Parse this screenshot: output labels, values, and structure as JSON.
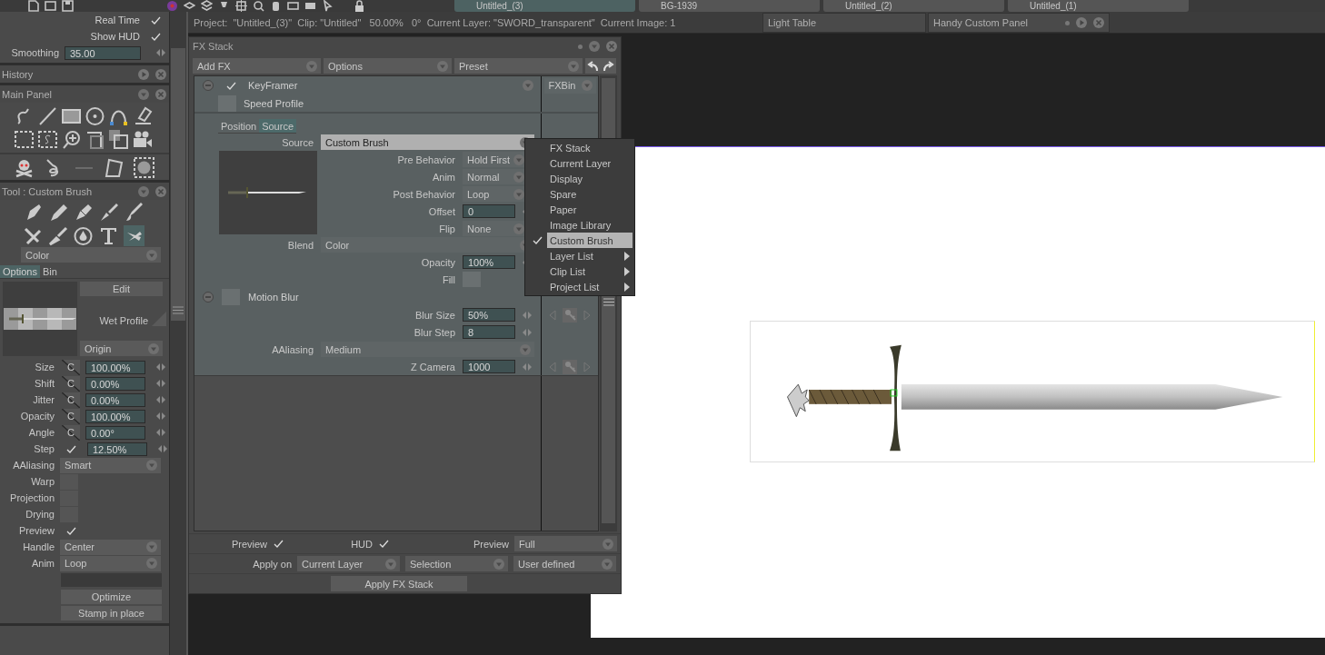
{
  "doc_tabs": [
    {
      "label": "Untitled_(3)",
      "selected": true
    },
    {
      "label": "BG-1939",
      "selected": false
    },
    {
      "label": "Untitled_(2)",
      "selected": false
    },
    {
      "label": "Untitled_(1)",
      "selected": false
    }
  ],
  "status_line": "Project:  \"Untitled_(3)\"  Clip: \"Untitled\"   50.00%   0°  Current Layer: \"SWORD_transparent\"  Current Image: 1",
  "light_table": {
    "title": "Light Table"
  },
  "handy_panel": {
    "title": "Handy Custom Panel"
  },
  "left_panel": {
    "toggles": [
      {
        "label": "Real Time",
        "checked": true
      },
      {
        "label": "Show HUD",
        "checked": true
      }
    ],
    "smoothing": {
      "label": "Smoothing",
      "value": "35.00"
    },
    "history": {
      "title": "History"
    },
    "main_panel": {
      "title": "Main Panel"
    },
    "tool_panel": {
      "title": "Tool : Custom Brush",
      "brush_tools": [
        {
          "selected": false
        },
        {
          "selected": false
        },
        {
          "selected": false
        },
        {
          "selected": false
        },
        {
          "selected": false
        },
        {
          "selected": false
        },
        {
          "selected": false
        },
        {
          "selected": false
        },
        {
          "selected": false
        },
        {
          "selected": true
        }
      ],
      "color_dropdown": "Color",
      "tabs": [
        {
          "label": "Options",
          "selected": true
        },
        {
          "label": "Bin",
          "selected": false
        }
      ],
      "edit_button": "Edit",
      "wet_profile": "Wet Profile",
      "origin": "Origin",
      "rows": [
        {
          "kind": "numeric",
          "label": "Size",
          "toggle": "C",
          "value": "100.00%"
        },
        {
          "kind": "numeric",
          "label": "Shift",
          "toggle": "C",
          "value": "0.00%"
        },
        {
          "kind": "numeric",
          "label": "Jitter",
          "toggle": "C",
          "value": "0.00%"
        },
        {
          "kind": "numeric",
          "label": "Opacity",
          "toggle": "C",
          "value": "100.00%"
        },
        {
          "kind": "numeric",
          "label": "Angle",
          "toggle": "C",
          "value": "0.00°"
        },
        {
          "kind": "numeric",
          "label": "Step",
          "checked": true,
          "value": "12.50%"
        },
        {
          "kind": "dropdown",
          "label": "AAliasing",
          "value": "Smart"
        },
        {
          "kind": "swatch",
          "label": "Warp"
        },
        {
          "kind": "swatch",
          "label": "Projection"
        },
        {
          "kind": "swatch",
          "label": "Drying"
        },
        {
          "kind": "check",
          "label": "Preview",
          "checked": true
        },
        {
          "kind": "dropdown",
          "label": "Handle",
          "value": "Center"
        },
        {
          "kind": "dropdown",
          "label": "Anim",
          "value": "Loop"
        }
      ],
      "buttons": [
        "Optimize",
        "Stamp in place"
      ]
    }
  },
  "fx_stack": {
    "title": "FX Stack",
    "toolbar": [
      "Add FX",
      "Options",
      "Preset"
    ],
    "fx_bin": "FXBin",
    "effects": [
      {
        "name": "KeyFramer",
        "enabled": true,
        "sub_toggle": {
          "label": "Speed Profile",
          "checked": false
        },
        "tabs": [
          {
            "label": "Position",
            "selected": false
          },
          {
            "label": "Source",
            "selected": true
          }
        ],
        "params": [
          {
            "kind": "wide_dropdown",
            "label": "Source",
            "value": "Custom Brush",
            "open": true
          },
          {
            "kind": "thumb_group",
            "items": [
              {
                "kind": "dropdown",
                "label": "Pre Behavior",
                "value": "Hold First"
              },
              {
                "kind": "dropdown",
                "label": "Anim",
                "value": "Normal"
              },
              {
                "kind": "dropdown",
                "label": "Post Behavior",
                "value": "Loop"
              },
              {
                "kind": "numeric",
                "label": "Offset",
                "value": "0"
              },
              {
                "kind": "dropdown",
                "label": "Flip",
                "value": "None"
              }
            ]
          },
          {
            "kind": "wide_dropdown",
            "label": "Blend",
            "value": "Color",
            "open": false
          },
          {
            "kind": "numeric",
            "label": "Opacity",
            "value": "100%"
          },
          {
            "kind": "swatch",
            "label": "Fill"
          }
        ]
      },
      {
        "name": "Motion Blur",
        "enabled": false,
        "params": [
          {
            "kind": "numeric",
            "label": "Blur Size",
            "value": "50%",
            "keyframes": true
          },
          {
            "kind": "numeric",
            "label": "Blur Step",
            "value": "8"
          },
          {
            "kind": "wide_dropdown",
            "label": "AAliasing",
            "value": "Medium",
            "open": false
          },
          {
            "kind": "numeric",
            "label": "Z Camera",
            "value": "1000",
            "keyframes": true
          }
        ]
      }
    ],
    "footer": {
      "preview": {
        "label": "Preview",
        "checked": true
      },
      "hud": {
        "label": "HUD",
        "checked": true
      },
      "preview_mode": {
        "label": "Preview",
        "value": "Full"
      },
      "apply_on": {
        "label": "Apply on",
        "options": [
          "Current Layer",
          "Selection",
          "User defined"
        ]
      },
      "apply_button": "Apply FX Stack"
    }
  },
  "source_menu": {
    "items": [
      {
        "label": "FX Stack",
        "selected": false,
        "submenu": false
      },
      {
        "label": "Current Layer",
        "selected": false,
        "submenu": false
      },
      {
        "label": "Display",
        "selected": false,
        "submenu": false
      },
      {
        "label": "Spare",
        "selected": false,
        "submenu": false
      },
      {
        "label": "Paper",
        "selected": false,
        "submenu": false
      },
      {
        "label": "Image Library",
        "selected": false,
        "submenu": false
      },
      {
        "label": "Custom Brush",
        "selected": true,
        "submenu": false
      },
      {
        "label": "Layer List",
        "selected": false,
        "submenu": true
      },
      {
        "label": "Clip List",
        "selected": false,
        "submenu": true
      },
      {
        "label": "Project List",
        "selected": false,
        "submenu": true
      }
    ]
  }
}
